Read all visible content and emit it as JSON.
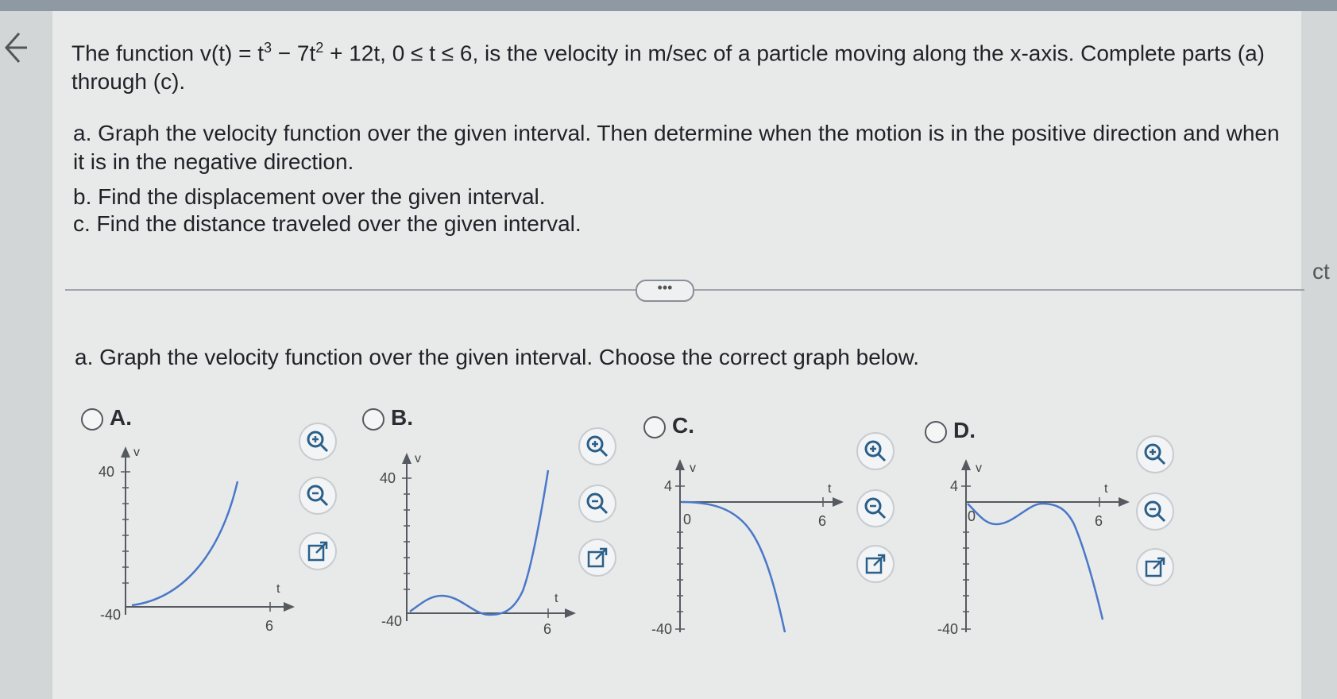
{
  "question": {
    "prefix": "The function v(t) = t",
    "exp1": "3",
    "mid1": " − 7t",
    "exp2": "2",
    "suffix": " + 12t, 0 ≤ t ≤ 6, is the velocity in m/sec of a particle moving along the x-axis. Complete parts (a) through (c)."
  },
  "parts": {
    "a": "a. Graph the velocity function over the given interval. Then determine when the motion is in the positive direction and when it is in the negative direction.",
    "b": "b. Find the displacement over the given interval.",
    "c": "c. Find the distance traveled over the given interval."
  },
  "more_button": "•••",
  "sub_prompt": "a. Graph the velocity function over the given interval. Choose the correct graph below.",
  "side_text": "ct",
  "colors": {
    "curve": "#4a78c8",
    "axis": "#555a60"
  },
  "options": [
    {
      "label": "A.",
      "y_top": "40",
      "y_bottom": "-40",
      "x_label": "t",
      "x_tick": "6",
      "y_axis_label": "v"
    },
    {
      "label": "B.",
      "y_top": "40",
      "y_bottom": "-40",
      "x_label": "t",
      "x_tick": "6",
      "y_axis_label": "v"
    },
    {
      "label": "C.",
      "y_top": "4",
      "y_bottom": "-40",
      "x_label": "t",
      "x_tick": "6",
      "origin_label": "0",
      "y_axis_label": "v"
    },
    {
      "label": "D.",
      "y_top": "4",
      "y_bottom": "-40",
      "x_label": "t",
      "x_tick": "6",
      "origin_label": "0",
      "y_axis_label": "v"
    }
  ],
  "tools": [
    "zoom-in-icon",
    "zoom-out-icon",
    "open-new-window-icon"
  ]
}
